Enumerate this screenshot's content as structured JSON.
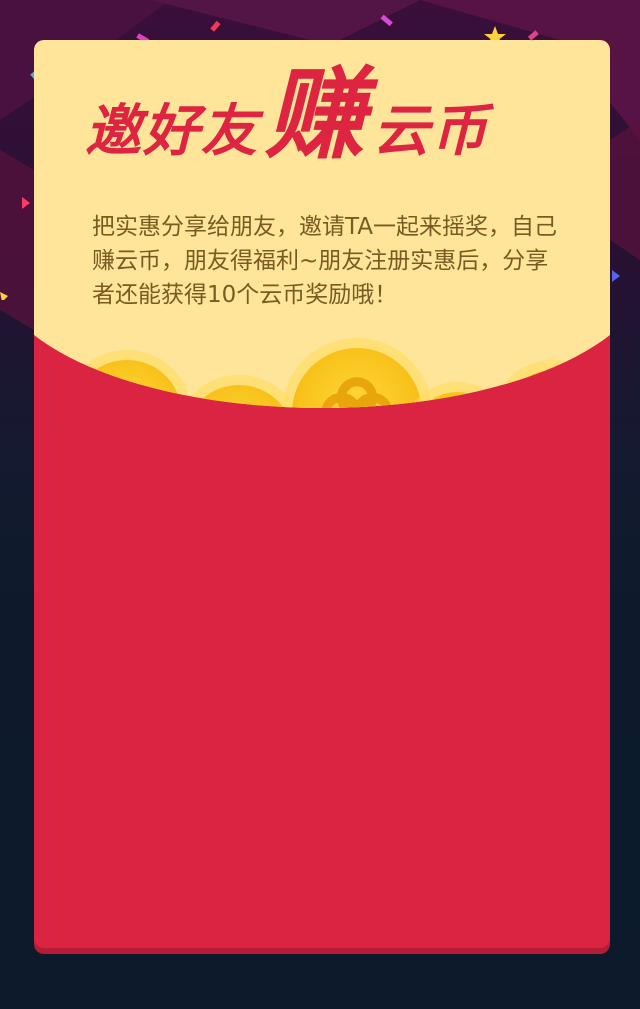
{
  "title": {
    "part1": "邀好友",
    "part2": "赚",
    "part3": "云币"
  },
  "description": "把实惠分享给朋友，邀请TA一起来摇奖，自己赚云币，朋友得福利~朋友注册实惠后，分享者还能获得10个云币奖励哦！",
  "colors": {
    "page_bg": "#0e1a2b",
    "envelope_red": "#db2442",
    "flap_yellow": "#ffe59a",
    "title_red": "#dd2441",
    "text_brown": "#7a5a21",
    "coin_gold": "#f8c21a"
  },
  "icons": [
    "star-icon",
    "coin-icon",
    "confetti-icon"
  ]
}
